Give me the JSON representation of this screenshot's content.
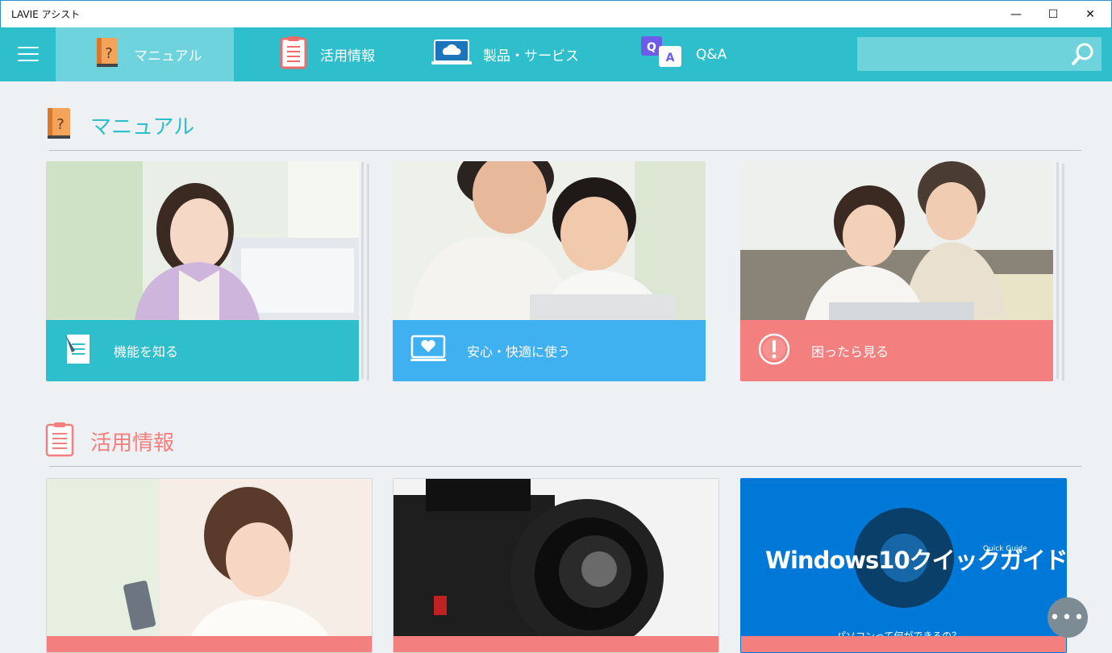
{
  "window": {
    "title": "LAVIE アシスト",
    "minimize": "—",
    "maximize": "☐",
    "close": "✕"
  },
  "nav": {
    "tabs": [
      {
        "label": "マニュアル",
        "icon": "manual-book-icon",
        "active": true
      },
      {
        "label": "活用情報",
        "icon": "clipboard-list-icon",
        "active": false
      },
      {
        "label": "製品・サービス",
        "icon": "cloud-monitor-icon",
        "active": false
      },
      {
        "label": "Q&A",
        "icon": "qa-bubbles-icon",
        "active": false
      }
    ],
    "search_placeholder": ""
  },
  "manual_section": {
    "title": "マニュアル",
    "color": "#2fbecb",
    "cards": [
      {
        "label": "機能を知る",
        "color": "#2fbecb",
        "icon": "document-pencil-icon",
        "photo": "woman-at-computer-photo"
      },
      {
        "label": "安心・快適に使う",
        "color": "#3fb0f0",
        "icon": "monitor-heart-icon",
        "photo": "father-son-laptop-photo"
      },
      {
        "label": "困ったら見る",
        "color": "#f47f7f",
        "icon": "alert-circle-icon",
        "photo": "women-laptop-photo"
      }
    ]
  },
  "info_section": {
    "title": "活用情報",
    "color": "#f47f7f",
    "cards": [
      {
        "photo": "woman-smartphone-photo"
      },
      {
        "photo": "camera-lens-photo"
      },
      {
        "banner_title": "Windows10クイックガイド!",
        "banner_subtitle": "Quick Guide",
        "banner_caption": "パソコンって何ができるの？",
        "bg": "#0078d7"
      }
    ]
  },
  "more_button": "•••"
}
